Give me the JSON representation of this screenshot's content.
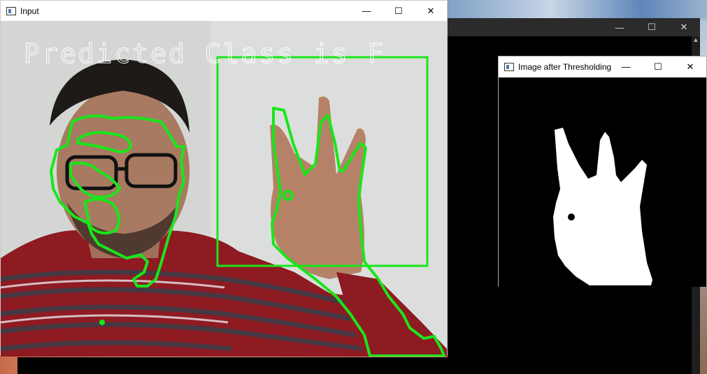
{
  "windows": {
    "input": {
      "title": "Input",
      "prediction_text": "Predicted Class is F"
    },
    "back": {
      "title": ""
    },
    "thresh": {
      "title": "Image after Thresholding"
    }
  },
  "controls": {
    "minimize": "—",
    "maximize": "☐",
    "close": "✕"
  },
  "colors": {
    "contour": "#19e619",
    "roi_box": "#19e619",
    "title_bar": "#ffffff",
    "threshold_bg": "#000000",
    "threshold_fg": "#ffffff"
  },
  "icons": {
    "app": "window-app-icon"
  }
}
